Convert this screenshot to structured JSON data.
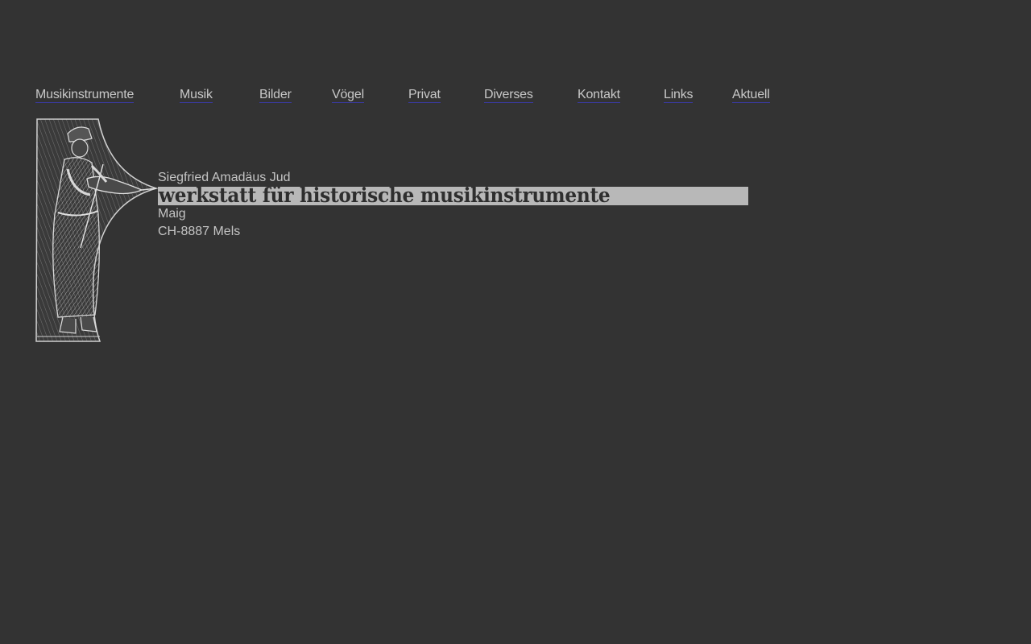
{
  "nav": {
    "items": [
      {
        "label": "Musikinstrumente"
      },
      {
        "label": "Musik"
      },
      {
        "label": "Bilder"
      },
      {
        "label": "Vögel"
      },
      {
        "label": "Privat"
      },
      {
        "label": "Diverses"
      },
      {
        "label": "Kontakt"
      },
      {
        "label": "Links"
      },
      {
        "label": "Aktuell"
      }
    ],
    "link_color": "#c8c8c8",
    "underline_color": "#3a3aa8"
  },
  "header": {
    "name": "Siegfried Amadäus Jud",
    "tagline": "werkstatt für historische musikinstrumente",
    "street": "Maig",
    "city": "CH-8887 Mels"
  },
  "emblem": {
    "icon": "violinist-woodcut-icon"
  },
  "colors": {
    "background": "#333333",
    "banner": "#b8b8b8",
    "text": "#c4c4c4"
  }
}
